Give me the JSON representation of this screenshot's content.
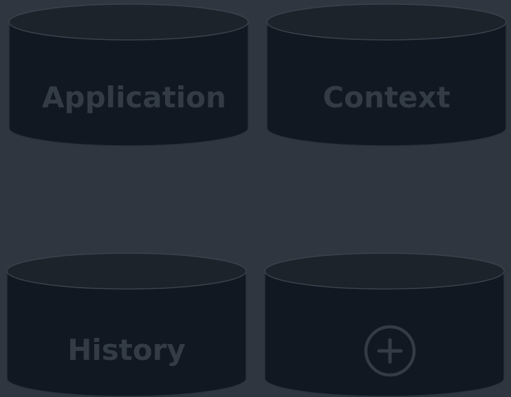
{
  "storage_tiles": [
    {
      "label": "Application"
    },
    {
      "label": "Context"
    },
    {
      "label": "History"
    }
  ],
  "add_tile": {
    "icon": "plus-circle-icon"
  },
  "colors": {
    "background": "#2f3640",
    "cylinder_body": "#111821",
    "cylinder_top": "#1d232b",
    "label_text": "#333b45"
  }
}
